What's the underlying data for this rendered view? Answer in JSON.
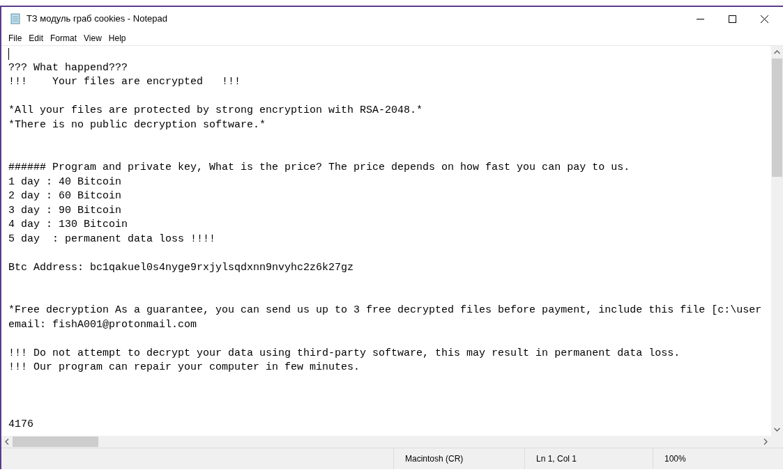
{
  "window": {
    "title": "ТЗ модуль граб cookies - Notepad"
  },
  "menu": [
    "File",
    "Edit",
    "Format",
    "View",
    "Help"
  ],
  "editor": {
    "lines": [
      {
        "kind": "blank"
      },
      {
        "kind": "text",
        "text": "??? What happend???"
      },
      {
        "kind": "text",
        "text": "!!!    Your files are encrypted   !!!"
      },
      {
        "kind": "blank"
      },
      {
        "kind": "text",
        "text": "*All your files are protected by strong encryption with RSA-2048.*"
      },
      {
        "kind": "text",
        "text": "*There is no public decryption software.*"
      },
      {
        "kind": "blank"
      },
      {
        "kind": "blank"
      },
      {
        "kind": "text",
        "text": "###### Program and private key, What is the price? The price depends on how fast you can pay to us."
      },
      {
        "kind": "text",
        "text": "1 day : 40 Bitcoin"
      },
      {
        "kind": "text",
        "text": "2 day : 60 Bitcoin"
      },
      {
        "kind": "text",
        "text": "3 day : 90 Bitcoin"
      },
      {
        "kind": "text",
        "text": "4 day : 130 Bitcoin"
      },
      {
        "kind": "text",
        "text": "5 day  : permanent data loss !!!!"
      },
      {
        "kind": "blank"
      },
      {
        "kind": "text",
        "text": "Btc Address: bc1qakuel0s4nyge9rxjylsqdxnn9nvyhc2z6k27gz"
      },
      {
        "kind": "blank"
      },
      {
        "kind": "blank"
      },
      {
        "kind": "text",
        "text": "*Free decryption As a guarantee, you can send us up to 3 free decrypted files before payment, include this file [c:\\user"
      },
      {
        "kind": "text",
        "text": "email: fishA001@protonmail.com"
      },
      {
        "kind": "blank"
      },
      {
        "kind": "text",
        "text": "!!! Do not attempt to decrypt your data using third-party software, this may result in permanent data loss."
      },
      {
        "kind": "text",
        "text": "!!! Our program can repair your computer in few minutes."
      },
      {
        "kind": "blank"
      },
      {
        "kind": "blank"
      },
      {
        "kind": "blank"
      },
      {
        "kind": "text",
        "text": "4176"
      }
    ]
  },
  "status_bar": [
    "Macintosh (CR)",
    "Ln 1, Col 1",
    "100%"
  ]
}
